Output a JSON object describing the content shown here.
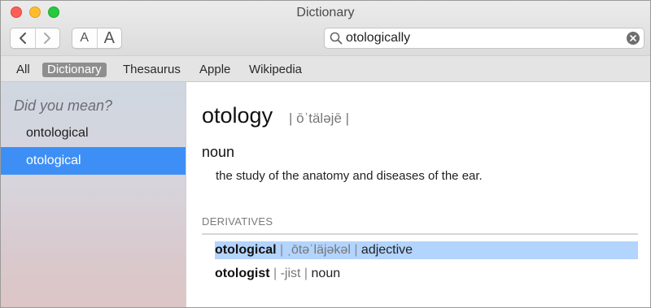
{
  "window": {
    "title": "Dictionary"
  },
  "toolbar": {
    "font_small_label": "A",
    "font_large_label": "A",
    "search": {
      "value": "otologically"
    }
  },
  "scopes": [
    {
      "label": "All"
    },
    {
      "label": "Dictionary"
    },
    {
      "label": "Thesaurus"
    },
    {
      "label": "Apple"
    },
    {
      "label": "Wikipedia"
    }
  ],
  "sidebar": {
    "header": "Did you mean?",
    "items": [
      {
        "label": "ontological"
      },
      {
        "label": "otological"
      }
    ]
  },
  "entry": {
    "headword": "otology",
    "pronunciation": "| ōˈtäləjē |",
    "part_of_speech": "noun",
    "definition": "the study of the anatomy and diseases of the ear.",
    "derivatives_header": "DERIVATIVES",
    "derivatives": [
      {
        "word": "otological",
        "sep1": " | ",
        "pronunciation": "ˌōtəˈläjəkəl",
        "sep2": " | ",
        "pos": "adjective"
      },
      {
        "word": "otologist",
        "sep1": " | ",
        "pronunciation": "-jist",
        "sep2": " | ",
        "pos": "noun"
      }
    ]
  },
  "colors": {
    "selection_blue": "#3d8ff5",
    "highlight_blue": "#b3d4fd",
    "scope_active": "#8e8e8e"
  }
}
